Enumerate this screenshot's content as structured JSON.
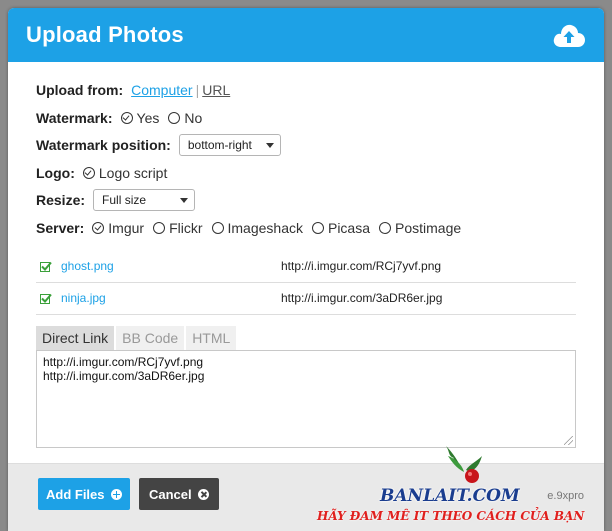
{
  "header": {
    "title": "Upload Photos",
    "icon": "cloud-upload-icon",
    "color": "#1da1e6"
  },
  "upload_from": {
    "label": "Upload from:",
    "computer": "Computer",
    "separator": "|",
    "url": "URL"
  },
  "watermark": {
    "label": "Watermark:",
    "options": [
      {
        "label": "Yes",
        "selected": true
      },
      {
        "label": "No",
        "selected": false
      }
    ]
  },
  "watermark_position": {
    "label": "Watermark position:",
    "value": "bottom-right"
  },
  "logo": {
    "label": "Logo:",
    "option": "Logo script",
    "selected": true
  },
  "resize": {
    "label": "Resize:",
    "value": "Full size"
  },
  "server": {
    "label": "Server:",
    "options": [
      {
        "label": "Imgur",
        "selected": true
      },
      {
        "label": "Flickr",
        "selected": false
      },
      {
        "label": "Imageshack",
        "selected": false
      },
      {
        "label": "Picasa",
        "selected": false
      },
      {
        "label": "Postimage",
        "selected": false
      }
    ]
  },
  "files": [
    {
      "name": "ghost.png",
      "url": "http://i.imgur.com/RCj7yvf.png"
    },
    {
      "name": "ninja.jpg",
      "url": "http://i.imgur.com/3aDR6er.jpg"
    }
  ],
  "tabs": [
    {
      "label": "Direct Link",
      "active": true
    },
    {
      "label": "BB Code",
      "active": false
    },
    {
      "label": "HTML",
      "active": false
    }
  ],
  "output_text": "http://i.imgur.com/RCj7yvf.png\nhttp://i.imgur.com/3aDR6er.jpg",
  "footer": {
    "add_label": "Add Files",
    "cancel_label": "Cancel",
    "credit": "e.9xpro"
  },
  "watermark_overlay": {
    "site": "BANLAIT.COM",
    "slogan": "HÃY ĐAM MÊ IT THEO CÁCH CỦA BẠN"
  }
}
